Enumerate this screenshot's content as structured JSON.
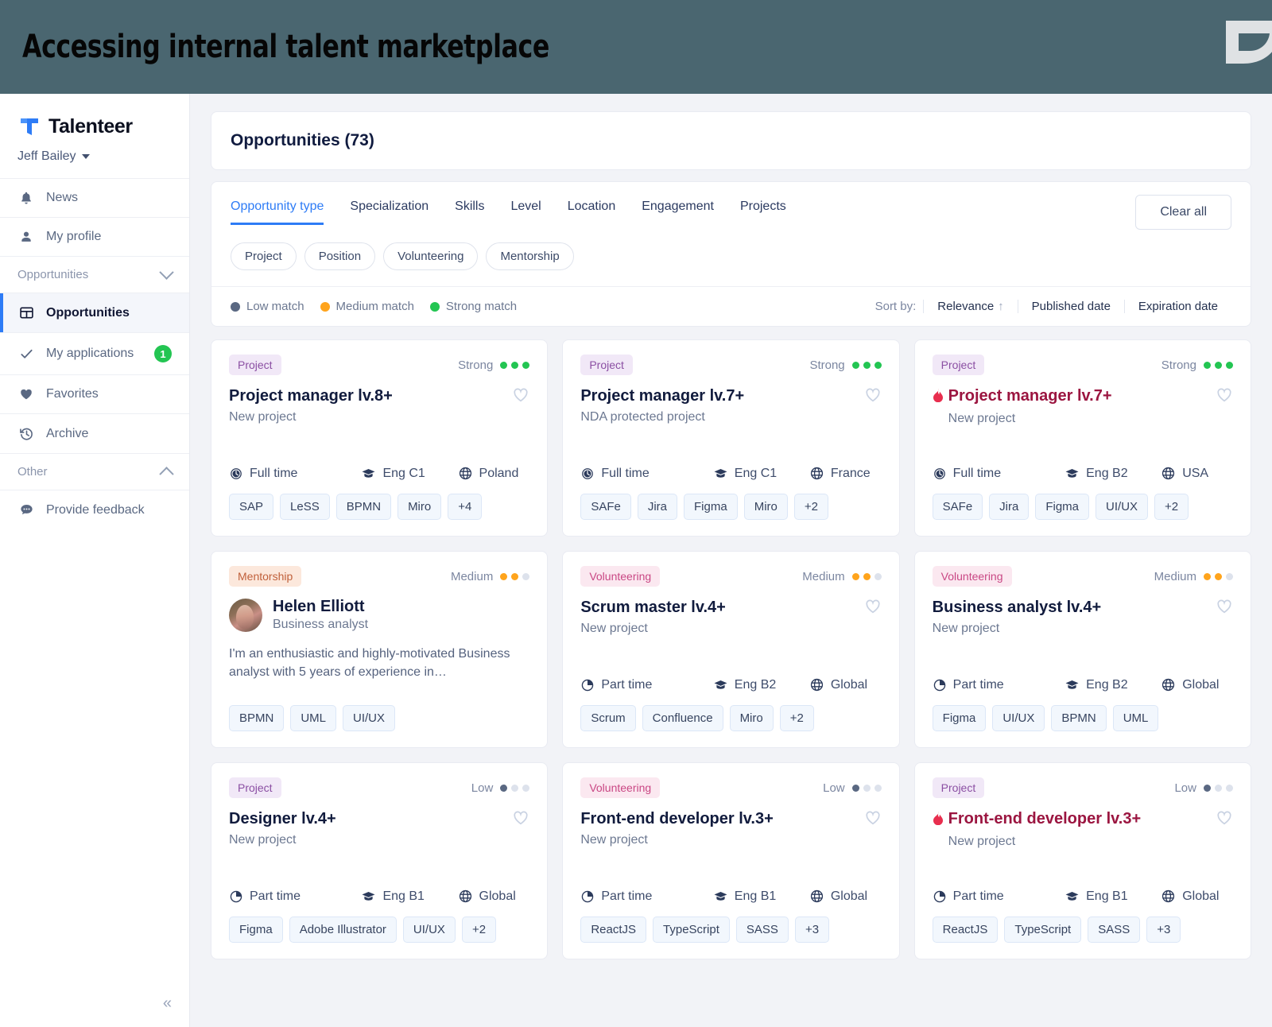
{
  "banner": {
    "title": "Accessing internal talent marketplace",
    "logo_icon": "leaf-mark-logo",
    "bg_color": "#4A6670"
  },
  "sidebar": {
    "brand": {
      "name": "Talenteer",
      "mark_icon": "talenteer-t-logo"
    },
    "user": {
      "name": "Jeff Bailey",
      "caret_icon": "caret-down-icon"
    },
    "items": [
      {
        "label": "News",
        "icon": "bell-icon"
      },
      {
        "label": "My profile",
        "icon": "person-icon"
      }
    ],
    "section_opportunities": {
      "label": "Opportunities",
      "chevron_icon": "chevron-down-icon"
    },
    "opportunity_items": [
      {
        "label": "Opportunities",
        "icon": "grid-table-icon",
        "active": true,
        "badge": ""
      },
      {
        "label": "My applications",
        "icon": "check-icon",
        "active": false,
        "badge": "1"
      },
      {
        "label": "Favorites",
        "icon": "heart-filled-icon",
        "active": false,
        "badge": ""
      },
      {
        "label": "Archive",
        "icon": "history-clock-icon",
        "active": false,
        "badge": ""
      }
    ],
    "section_other": {
      "label": "Other",
      "chevron_icon": "chevron-up-icon"
    },
    "other_items": [
      {
        "label": "Provide feedback",
        "icon": "chat-bubble-icon"
      }
    ],
    "collapse_label": "«"
  },
  "header": {
    "title": "Opportunities (73)"
  },
  "filters": {
    "tabs": [
      {
        "label": "Opportunity type",
        "active": true
      },
      {
        "label": "Specialization",
        "active": false
      },
      {
        "label": "Skills",
        "active": false
      },
      {
        "label": "Level",
        "active": false
      },
      {
        "label": "Location",
        "active": false
      },
      {
        "label": "Engagement",
        "active": false
      },
      {
        "label": "Projects",
        "active": false
      }
    ],
    "clear_all_label": "Clear all",
    "pills": [
      "Project",
      "Position",
      "Volunteering",
      "Mentorship"
    ]
  },
  "legend": [
    {
      "label": "Low match",
      "color": "#5A6882"
    },
    {
      "label": "Medium match",
      "color": "#FFA41C"
    },
    {
      "label": "Strong match",
      "color": "#23C552"
    }
  ],
  "sort": {
    "label": "Sort by:",
    "options": [
      "Relevance",
      "Published date",
      "Expiration date"
    ],
    "active": "Relevance",
    "arrow_icon": "arrow-up-icon",
    "arrow_glyph": "↑"
  },
  "cards": [
    {
      "type": "Project",
      "type_class": "tb-project",
      "match_label": "Strong",
      "match_level": 3,
      "match_class": "on-strong",
      "title": "Project manager lv.8+",
      "hot": false,
      "subtitle": "New project",
      "employment": "Full time",
      "employment_icon": "clock-full-icon",
      "language": "Eng C1",
      "language_icon": "graduation-cap-icon",
      "location": "Poland",
      "location_icon": "globe-icon",
      "skills": [
        "SAP",
        "LeSS",
        "BPMN",
        "Miro",
        "+4"
      ],
      "favorite_icon": "heart-outline-icon"
    },
    {
      "type": "Project",
      "type_class": "tb-project",
      "match_label": "Strong",
      "match_level": 3,
      "match_class": "on-strong",
      "title": "Project manager lv.7+",
      "hot": false,
      "subtitle": "NDA protected project",
      "employment": "Full time",
      "employment_icon": "clock-full-icon",
      "language": "Eng C1",
      "language_icon": "graduation-cap-icon",
      "location": "France",
      "location_icon": "globe-icon",
      "skills": [
        "SAFe",
        "Jira",
        "Figma",
        "Miro",
        "+2"
      ],
      "favorite_icon": "heart-outline-icon"
    },
    {
      "type": "Project",
      "type_class": "tb-project",
      "match_label": "Strong",
      "match_level": 3,
      "match_class": "on-strong",
      "title": "Project manager lv.7+",
      "hot": true,
      "hot_icon": "flame-icon",
      "subtitle": "New project",
      "employment": "Full time",
      "employment_icon": "clock-full-icon",
      "language": "Eng B2",
      "language_icon": "graduation-cap-icon",
      "location": "USA",
      "location_icon": "globe-icon",
      "skills": [
        "SAFe",
        "Jira",
        "Figma",
        "UI/UX",
        "+2"
      ],
      "favorite_icon": "heart-outline-icon"
    },
    {
      "type": "Mentorship",
      "type_class": "tb-mentorship",
      "match_label": "Medium",
      "match_level": 2,
      "match_class": "on-medium",
      "mentor": true,
      "mentor_name": "Helen Elliott",
      "mentor_role": "Business analyst",
      "mentor_avatar_icon": "avatar-photo",
      "mentor_desc": "I'm an enthusiastic and highly-motivated Business analyst with 5 years of experience in…",
      "skills": [
        "BPMN",
        "UML",
        "UI/UX"
      ]
    },
    {
      "type": "Volunteering",
      "type_class": "tb-volunteering",
      "match_label": "Medium",
      "match_level": 2,
      "match_class": "on-medium",
      "title": "Scrum master lv.4+",
      "hot": false,
      "subtitle": "New project",
      "employment": "Part time",
      "employment_icon": "clock-half-icon",
      "language": "Eng B2",
      "language_icon": "graduation-cap-icon",
      "location": "Global",
      "location_icon": "globe-icon",
      "skills": [
        "Scrum",
        "Confluence",
        "Miro",
        "+2"
      ],
      "favorite_icon": "heart-outline-icon"
    },
    {
      "type": "Volunteering",
      "type_class": "tb-volunteering",
      "match_label": "Medium",
      "match_level": 2,
      "match_class": "on-medium",
      "title": "Business analyst lv.4+",
      "hot": false,
      "subtitle": "New project",
      "employment": "Part time",
      "employment_icon": "clock-half-icon",
      "language": "Eng B2",
      "language_icon": "graduation-cap-icon",
      "location": "Global",
      "location_icon": "globe-icon",
      "skills": [
        "Figma",
        "UI/UX",
        "BPMN",
        "UML"
      ],
      "favorite_icon": "heart-outline-icon"
    },
    {
      "type": "Project",
      "type_class": "tb-project",
      "match_label": "Low",
      "match_level": 1,
      "match_class": "on-low",
      "title": "Designer lv.4+",
      "hot": false,
      "subtitle": "New project",
      "employment": "Part time",
      "employment_icon": "clock-half-icon",
      "language": "Eng B1",
      "language_icon": "graduation-cap-icon",
      "location": "Global",
      "location_icon": "globe-icon",
      "skills": [
        "Figma",
        "Adobe Illustrator",
        "UI/UX",
        "+2"
      ],
      "favorite_icon": "heart-outline-icon"
    },
    {
      "type": "Volunteering",
      "type_class": "tb-volunteering",
      "match_label": "Low",
      "match_level": 1,
      "match_class": "on-low",
      "title": "Front-end developer lv.3+",
      "hot": false,
      "subtitle": "New project",
      "employment": "Part time",
      "employment_icon": "clock-half-icon",
      "language": "Eng B1",
      "language_icon": "graduation-cap-icon",
      "location": "Global",
      "location_icon": "globe-icon",
      "skills": [
        "ReactJS",
        "TypeScript",
        "SASS",
        "+3"
      ],
      "favorite_icon": "heart-outline-icon"
    },
    {
      "type": "Project",
      "type_class": "tb-project",
      "match_label": "Low",
      "match_level": 1,
      "match_class": "on-low",
      "title": "Front-end developer lv.3+",
      "hot": true,
      "hot_icon": "flame-icon",
      "subtitle": "New project",
      "employment": "Part time",
      "employment_icon": "clock-half-icon",
      "language": "Eng B1",
      "language_icon": "graduation-cap-icon",
      "location": "Global",
      "location_icon": "globe-icon",
      "skills": [
        "ReactJS",
        "TypeScript",
        "SASS",
        "+3"
      ],
      "favorite_icon": "heart-outline-icon"
    }
  ]
}
